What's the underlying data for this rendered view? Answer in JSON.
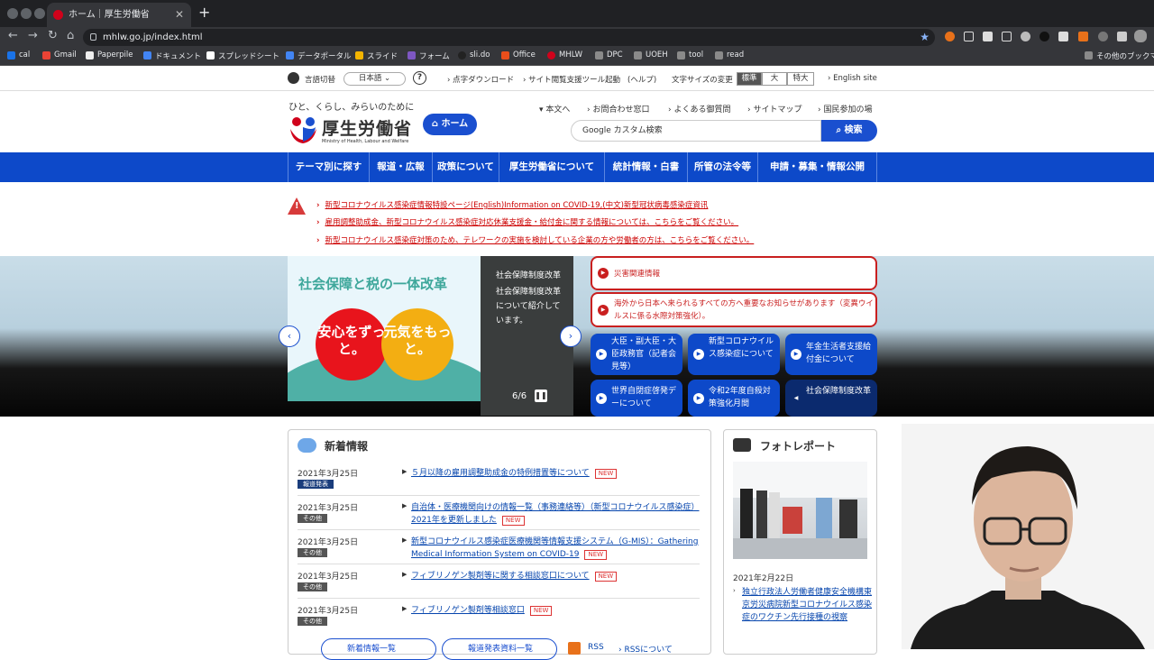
{
  "browser": {
    "tab_title": "ホーム｜厚生労働省",
    "url": "mhlw.go.jp/index.html"
  },
  "bookmarks": [
    "cal",
    "Gmail",
    "Paperpile",
    "ドキュメント",
    "スプレッドシート",
    "データポータル",
    "スライド",
    "フォーム",
    "sli.do",
    "Office",
    "MHLW",
    "DPC",
    "UOEH",
    "tool",
    "read"
  ],
  "other_bookmarks": "その他のブックマ",
  "util": {
    "lang_label": "言語切替",
    "lang_value": "日本語",
    "tenji": "点字ダウンロード",
    "reader": "サイト閲覧支援ツール起動",
    "help": "(ヘルプ)",
    "fontsize_label": "文字サイズの変更",
    "fs_std": "標準",
    "fs_large": "大",
    "fs_xl": "特大",
    "english": "English site"
  },
  "header": {
    "tagline": "ひと、くらし、みらいのために",
    "logo": "厚生労働省",
    "logo_en": "Ministry of Health, Labour and Welfare",
    "home": "ホーム",
    "links": [
      "本文へ",
      "お問合わせ窓口",
      "よくある御質問",
      "サイトマップ",
      "国民参加の場"
    ],
    "search_placeholder": "Google カスタム検索",
    "search_btn": "検索"
  },
  "mainnav": [
    "テーマ別に探す",
    "報道・広報",
    "政策について",
    "厚生労働省について",
    "統計情報・白書",
    "所管の法令等",
    "申請・募集・情報公開"
  ],
  "alerts": [
    "新型コロナウイルス感染症情報特設ページ(English)Information on COVID-19,(中文)新型冠状病毒感染症資讯",
    "雇用調整助成金、新型コロナウイルス感染症対応休業支援金・給付金に関する情報については、こちらをご覧ください。",
    "新型コロナウイルス感染症対策のため、テレワークの実施を検討している企業の方や労働者の方は、こちらをご覧ください。"
  ],
  "slide": {
    "title": "社会保障と税の一体改革",
    "bubble1": "安心をずっと。",
    "bubble2": "元気をもっと。",
    "caption_head": "社会保障制度改革",
    "caption_body": "社会保障制度改革について紹介しています。",
    "counter": "6/6"
  },
  "red_links": [
    "災害関連情報",
    "海外から日本へ来られるすべての方へ重要なお知らせがあります（変異ウイルスに係る水際対策強化）。"
  ],
  "blue_links": [
    "大臣・副大臣・大臣政務官（記者会見等）",
    "新型コロナウイルス感染症について",
    "年金生活者支援給付金について",
    "世界自閉症啓発デーについて",
    "令和2年度自殺対策強化月間",
    "社会保障制度改革"
  ],
  "news": {
    "title": "新着情報",
    "items": [
      {
        "date": "2021年3月25日",
        "badge": "報道発表",
        "text": "５月以降の雇用調整助成金の特例措置等について",
        "new": "NEW"
      },
      {
        "date": "2021年3月25日",
        "badge": "その他",
        "text": "自治体・医療機関向けの情報一覧（事務連絡等）（新型コロナウイルス感染症）2021年を更新しました",
        "new": "NEW"
      },
      {
        "date": "2021年3月25日",
        "badge": "その他",
        "text": "新型コロナウイルス感染症医療機関等情報支援システム（G-MIS）：Gathering Medical Information System on COVID-19",
        "new": "NEW"
      },
      {
        "date": "2021年3月25日",
        "badge": "その他",
        "text": "フィブリノゲン製剤等に関する相談窓口について",
        "new": "NEW"
      },
      {
        "date": "2021年3月25日",
        "badge": "その他",
        "text": "フィブリノゲン製剤等相談窓口",
        "new": "NEW"
      }
    ],
    "btn1": "新着情報一覧",
    "btn2": "報道発表資料一覧",
    "rss": "RSS",
    "rss2": "RSSについて"
  },
  "photo": {
    "title": "フォトレポート",
    "date": "2021年2月22日",
    "link": "独立行政法人労働者健康安全機構東京労災病院新型コロナウイルス感染症のワクチン先行接種の視察"
  }
}
